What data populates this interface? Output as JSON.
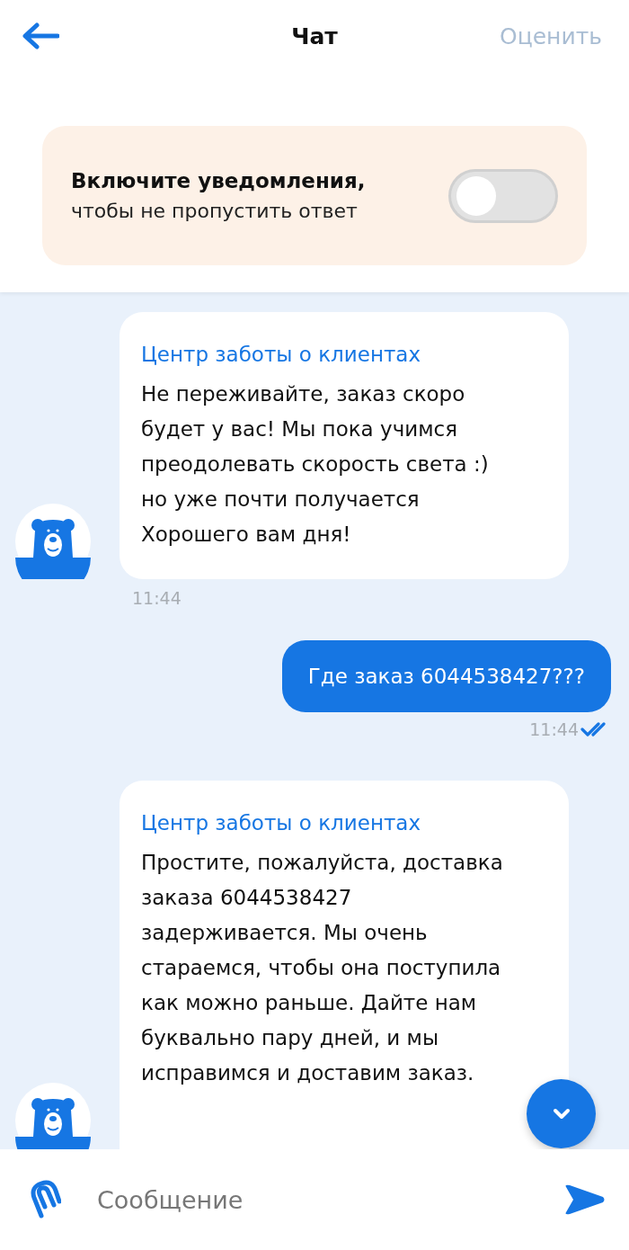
{
  "header": {
    "title": "Чат",
    "action": "Оценить"
  },
  "notifications": {
    "title": "Включите уведомления,",
    "subtitle": "чтобы не пропустить ответ",
    "on": false
  },
  "messages": [
    {
      "kind": "incoming",
      "sender": "Центр заботы о клиентах",
      "text": "Не переживайте, заказ скоро будет у вас! Мы пока учимся преодолевать скорость света :) но уже почти получается\nХорошего вам дня!",
      "time": "11:44"
    },
    {
      "kind": "outgoing",
      "text": "Где заказ 6044538427???",
      "time": "11:44",
      "read": true
    },
    {
      "kind": "incoming",
      "sender": "Центр заботы о клиентах",
      "text": "Простите, пожалуйста, доставка заказа 6044538427 задерживается. Мы очень стараемся, чтобы она поступила как можно раньше.  Дайте нам буквально пару дней, и мы исправимся и доставим заказ."
    }
  ],
  "composer": {
    "placeholder": "Сообщение"
  }
}
